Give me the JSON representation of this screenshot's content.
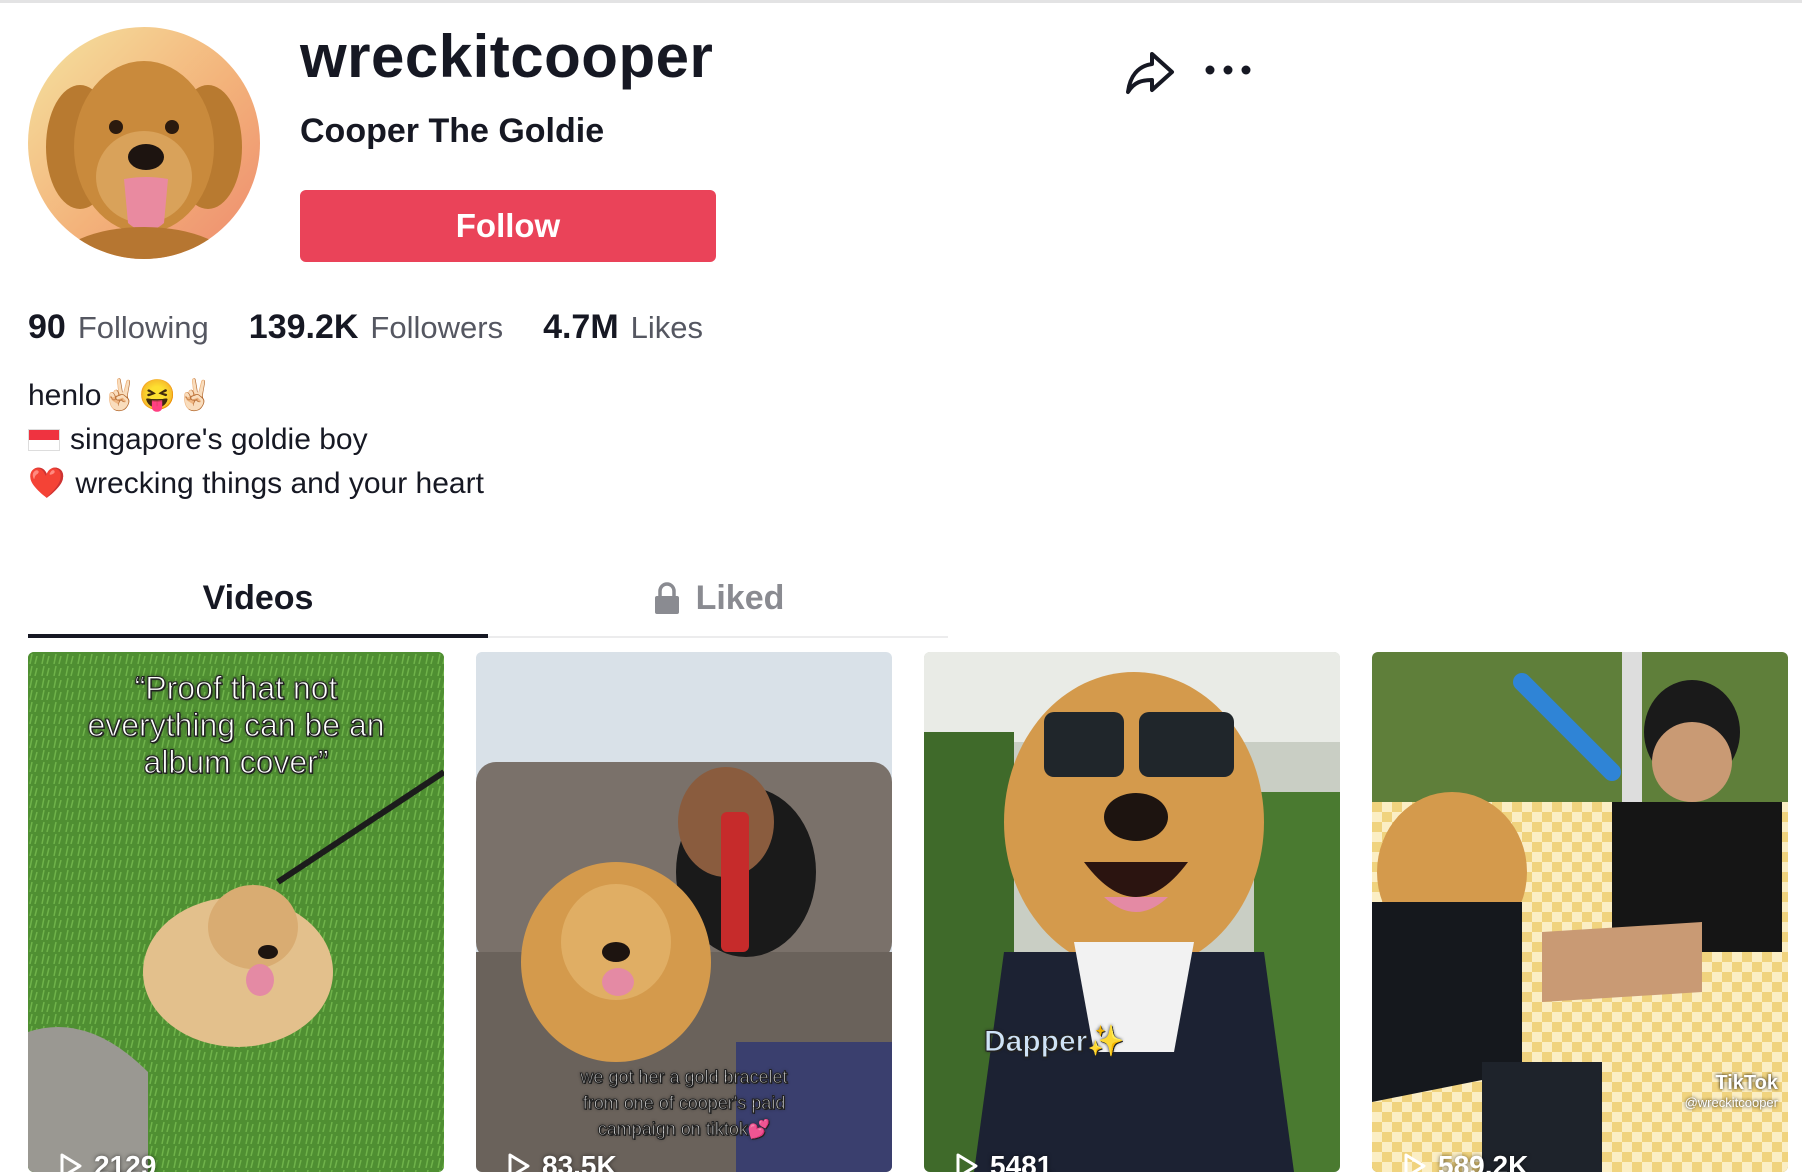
{
  "profile": {
    "username": "wreckitcooper",
    "nickname": "Cooper The Goldie",
    "follow_label": "Follow",
    "accent_color": "#ea4359"
  },
  "stats": [
    {
      "value": "90",
      "label": "Following"
    },
    {
      "value": "139.2K",
      "label": "Followers"
    },
    {
      "value": "4.7M",
      "label": "Likes"
    }
  ],
  "bio": {
    "line1_text": "henlo",
    "line1_emojis": "✌🏻😝✌🏻",
    "line2_text": "singapore's goldie boy",
    "line3_emoji": "❤️",
    "line3_text": "wrecking things and your heart"
  },
  "tabs": [
    {
      "label": "Videos",
      "active": true
    },
    {
      "label": "Liked",
      "active": false,
      "icon": "lock-icon"
    }
  ],
  "videos": [
    {
      "caption": "“Proof that not\neverything can be an\nalbum cover”",
      "views": "2129"
    },
    {
      "caption": "we got her a gold bracelet\nfrom one of cooper's paid\ncampaign on tiktok💕",
      "views": "83.5K"
    },
    {
      "caption": "Dapper✨",
      "views": "5481"
    },
    {
      "caption": "",
      "views": "589.2K",
      "watermark": "TikTok",
      "watermark_handle": "@wreckitcooper"
    }
  ],
  "icons": [
    "share-icon",
    "more-icon",
    "lock-icon",
    "play-icon"
  ]
}
